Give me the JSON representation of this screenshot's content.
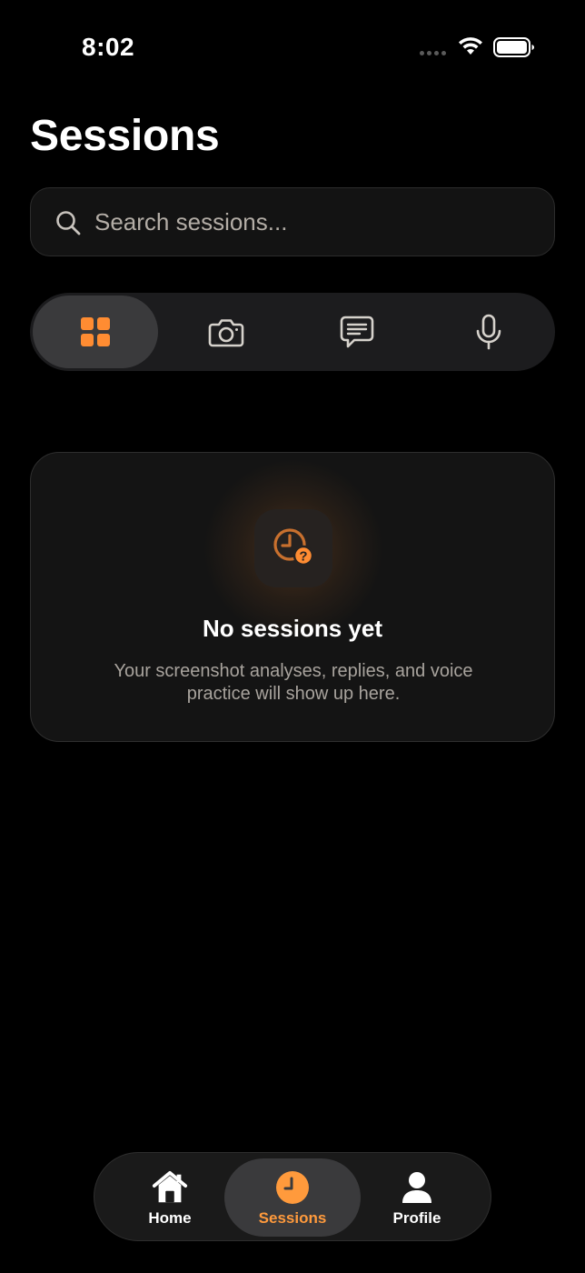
{
  "status_bar": {
    "time": "8:02",
    "icons": [
      "signal-dots-icon",
      "wifi-icon",
      "battery-icon"
    ]
  },
  "page": {
    "title": "Sessions"
  },
  "search": {
    "placeholder": "Search sessions...",
    "value": ""
  },
  "filters": {
    "selected": "all",
    "items": [
      {
        "id": "all",
        "icon": "grid-icon"
      },
      {
        "id": "screenshots",
        "icon": "camera-icon"
      },
      {
        "id": "replies",
        "icon": "message-icon"
      },
      {
        "id": "voice",
        "icon": "microphone-icon"
      }
    ]
  },
  "empty_state": {
    "icon": "clock-question-icon",
    "title": "No sessions yet",
    "description": "Your screenshot analyses, replies, and voice practice will show up here."
  },
  "tab_bar": {
    "active": "sessions",
    "items": [
      {
        "id": "home",
        "label": "Home",
        "icon": "home-icon"
      },
      {
        "id": "sessions",
        "label": "Sessions",
        "icon": "clock-icon"
      },
      {
        "id": "profile",
        "label": "Profile",
        "icon": "person-icon"
      }
    ]
  },
  "colors": {
    "accent": "#ff8c32",
    "background": "#000000",
    "surface": "#141414",
    "muted_text": "#a8a39d"
  }
}
